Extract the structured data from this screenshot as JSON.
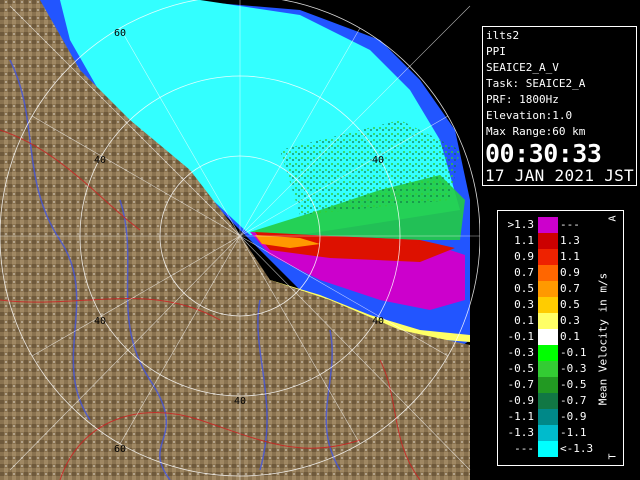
{
  "info": {
    "lines": [
      "ilts2",
      "PPI",
      "SEAICE2_A_V",
      "Task: SEAICE2_A",
      "PRF: 1800Hz",
      "Elevation:1.0",
      "Max Range:60 km"
    ],
    "time": "00:30:33",
    "date": "17 JAN 2021 JST"
  },
  "range_rings": [
    "20",
    "40",
    "60"
  ],
  "legend": {
    "title": "Mean Velocity in m/s",
    "top_mark": "A",
    "bottom_mark": "T",
    "rows": [
      {
        "left": ">1.3",
        "right": "---",
        "color": "#cc00cc"
      },
      {
        "left": "1.1",
        "right": "1.3",
        "color": "#cc0000"
      },
      {
        "left": "0.9",
        "right": "1.1",
        "color": "#ee2200"
      },
      {
        "left": "0.7",
        "right": "0.9",
        "color": "#ff6600"
      },
      {
        "left": "0.5",
        "right": "0.7",
        "color": "#ff9900"
      },
      {
        "left": "0.3",
        "right": "0.5",
        "color": "#ffcc00"
      },
      {
        "left": "0.1",
        "right": "0.3",
        "color": "#ffff66"
      },
      {
        "left": "-0.1",
        "right": "0.1",
        "color": "#ffffff"
      },
      {
        "left": "-0.3",
        "right": "-0.1",
        "color": "#00ff00"
      },
      {
        "left": "-0.5",
        "right": "-0.3",
        "color": "#33cc33"
      },
      {
        "left": "-0.7",
        "right": "-0.5",
        "color": "#229922"
      },
      {
        "left": "-0.9",
        "right": "-0.7",
        "color": "#117744"
      },
      {
        "left": "-1.1",
        "right": "-0.9",
        "color": "#008888"
      },
      {
        "left": "-1.3",
        "right": "-1.1",
        "color": "#00bbcc"
      },
      {
        "left": "---",
        "right": "<-1.3",
        "color": "#00ffff"
      }
    ]
  },
  "colors": {
    "land": "#8a7350",
    "sea_positive": "#cc00cc",
    "sea_negative": "#33ffff",
    "blue": "#2255ff"
  }
}
